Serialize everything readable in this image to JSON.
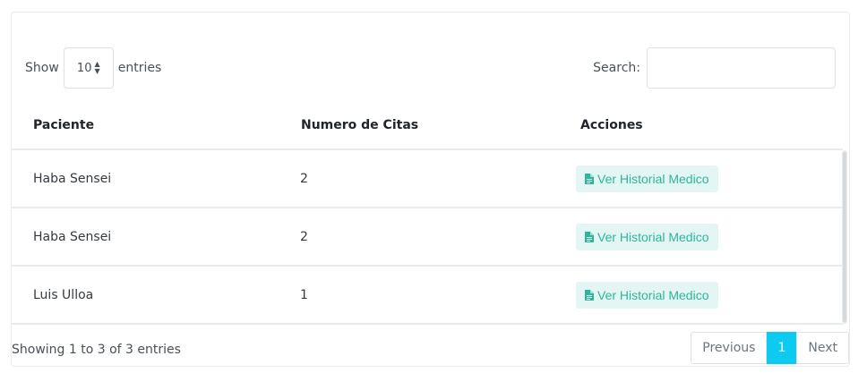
{
  "length": {
    "show_label": "Show",
    "selected": "10",
    "entries_label": "entries"
  },
  "search": {
    "label": "Search:",
    "value": "",
    "placeholder": ""
  },
  "table": {
    "headers": [
      "Paciente",
      "Numero de Citas",
      "Acciones"
    ],
    "rows": [
      {
        "paciente": "Haba Sensei",
        "citas": "2",
        "action": "Ver Historial Medico"
      },
      {
        "paciente": "Haba Sensei",
        "citas": "2",
        "action": "Ver Historial Medico"
      },
      {
        "paciente": "Luis Ulloa",
        "citas": "1",
        "action": "Ver Historial Medico"
      }
    ]
  },
  "info": "Showing 1 to 3 of 3 entries",
  "pagination": {
    "previous": "Previous",
    "current": "1",
    "next": "Next"
  },
  "icons": {
    "action": "file-text-icon"
  },
  "colors": {
    "action_bg": "#e3f6f3",
    "action_text": "#2fb59c",
    "active_page": "#0dcaf0"
  }
}
